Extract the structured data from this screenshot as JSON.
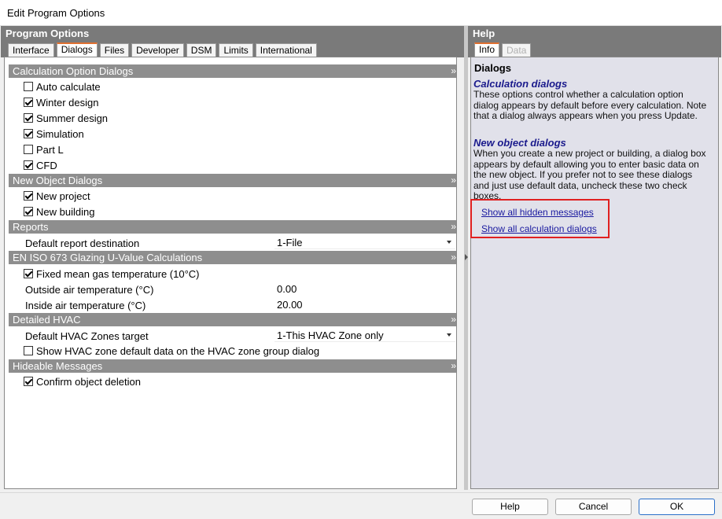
{
  "window": {
    "title": "Edit Program Options"
  },
  "left": {
    "title": "Program Options",
    "tabs": [
      {
        "label": "Interface"
      },
      {
        "label": "Dialogs"
      },
      {
        "label": "Files"
      },
      {
        "label": "Developer"
      },
      {
        "label": "DSM"
      },
      {
        "label": "Limits"
      },
      {
        "label": "International"
      }
    ],
    "active_tab": "Dialogs",
    "groups": {
      "calc": {
        "title": "Calculation Option Dialogs",
        "items": [
          {
            "label": "Auto calculate",
            "checked": false
          },
          {
            "label": "Winter design",
            "checked": true
          },
          {
            "label": "Summer design",
            "checked": true
          },
          {
            "label": "Simulation",
            "checked": true
          },
          {
            "label": "Part L",
            "checked": false
          },
          {
            "label": "CFD",
            "checked": true
          }
        ]
      },
      "newobj": {
        "title": "New Object Dialogs",
        "items": [
          {
            "label": "New project",
            "checked": true
          },
          {
            "label": "New building",
            "checked": true
          }
        ]
      },
      "reports": {
        "title": "Reports",
        "default_dest_label": "Default report destination",
        "default_dest_value": "1-File"
      },
      "eniso": {
        "title": "EN ISO 673 Glazing U-Value Calculations",
        "fixed_gas_label": "Fixed mean gas temperature (10°C)",
        "fixed_gas_checked": true,
        "outside_label": "Outside air temperature (°C)",
        "outside_value": "0.00",
        "inside_label": "Inside air temperature (°C)",
        "inside_value": "20.00"
      },
      "hvac": {
        "title": "Detailed HVAC",
        "zones_target_label": "Default HVAC Zones target",
        "zones_target_value": "1-This HVAC Zone only",
        "show_default_label": "Show HVAC zone default data on the HVAC zone group dialog",
        "show_default_checked": false
      },
      "hideable": {
        "title": "Hideable Messages",
        "confirm_label": "Confirm object deletion",
        "confirm_checked": true
      }
    },
    "chevron": "»"
  },
  "right": {
    "title": "Help",
    "tabs": [
      {
        "label": "Info"
      },
      {
        "label": "Data"
      }
    ],
    "heading": "Dialogs",
    "calc_title": "Calculation dialogs",
    "calc_text": "These options control whether a calculation option dialog appears by default before every calculation. Note that a dialog always appears when you press Update.",
    "newobj_title": "New object dialogs",
    "newobj_text": "When you create a new project or building, a dialog box appears by default allowing you to enter basic data on the new object.  If you prefer not to see these dialogs and just use default data, uncheck these two check boxes.",
    "link_hidden": "Show all hidden messages",
    "link_calc": "Show all calculation dialogs"
  },
  "buttons": {
    "help": "Help",
    "cancel": "Cancel",
    "ok": "OK"
  }
}
